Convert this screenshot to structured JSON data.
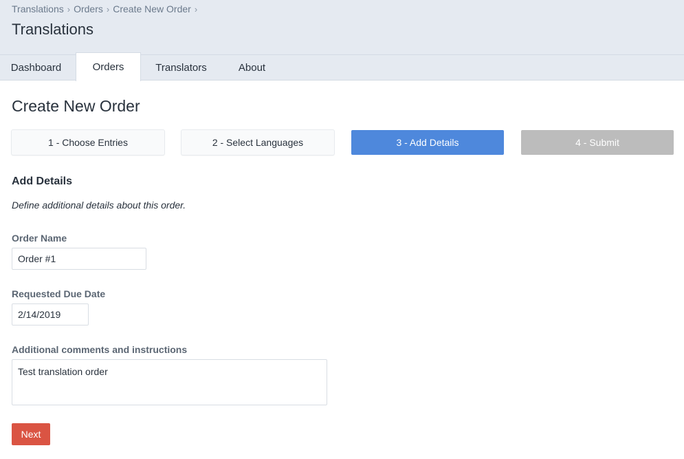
{
  "header": {
    "breadcrumbs": [
      "Translations",
      "Orders",
      "Create New Order"
    ],
    "separator": "›",
    "title": "Translations"
  },
  "tabs": [
    {
      "label": "Dashboard"
    },
    {
      "label": "Orders",
      "active": true
    },
    {
      "label": "Translators"
    },
    {
      "label": "About"
    }
  ],
  "main": {
    "title": "Create New Order",
    "steps": [
      {
        "label": "1 - Choose Entries",
        "state": "complete"
      },
      {
        "label": "2 - Select Languages",
        "state": "complete"
      },
      {
        "label": "3 - Add Details",
        "state": "current"
      },
      {
        "label": "4 - Submit",
        "state": "disabled"
      }
    ],
    "section": {
      "heading": "Add Details",
      "description": "Define additional details about this order."
    },
    "form": {
      "order_name": {
        "label": "Order Name",
        "value": "Order #1"
      },
      "due_date": {
        "label": "Requested Due Date",
        "value": "2/14/2019"
      },
      "comments": {
        "label": "Additional comments and instructions",
        "value": "Test translation order"
      }
    },
    "next_label": "Next"
  },
  "colors": {
    "header_bg": "#e5eaf1",
    "step_current": "#4e88dc",
    "step_disabled": "#bcbcbc",
    "next_button": "#da5443"
  }
}
